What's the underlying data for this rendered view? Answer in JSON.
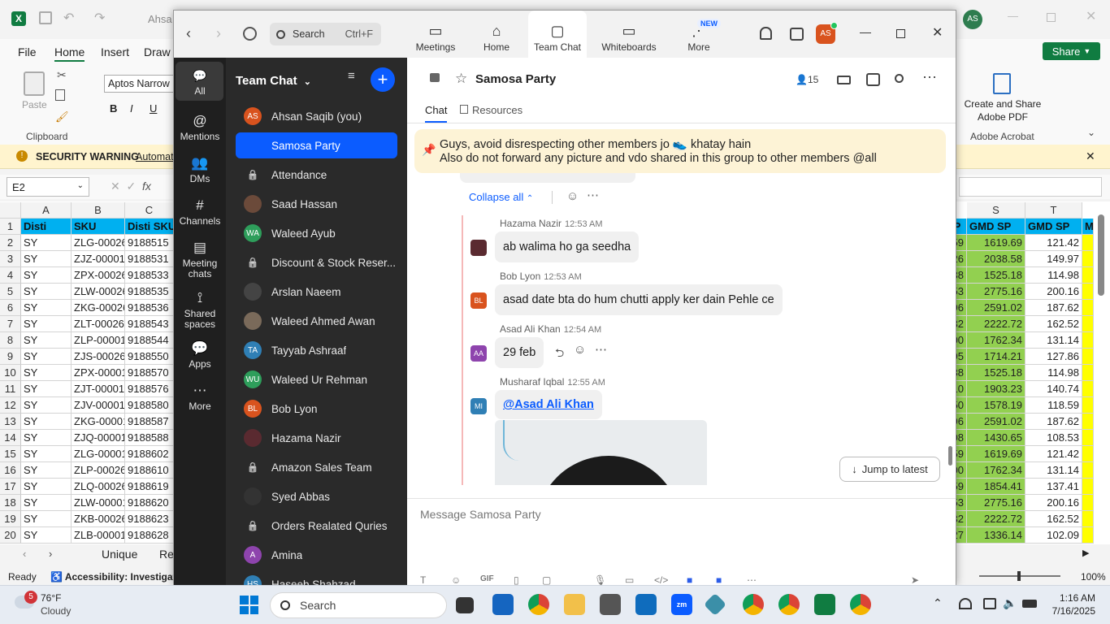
{
  "excel": {
    "title_partial": "Ahsa",
    "menu": [
      "File",
      "Home",
      "Insert",
      "Draw"
    ],
    "share_label": "Share",
    "clipboard_group": "Clipboard",
    "paste_label": "Paste",
    "font_name": "Aptos Narrow",
    "adobe_button": "Create and Share Adobe PDF",
    "adobe_group": "Adobe Acrobat",
    "security_label": "SECURITY WARNING",
    "security_text": "Automat",
    "name_box": "E2",
    "sheet_tab": "Unique",
    "sheet_tab2": "Re",
    "status_ready": "Ready",
    "status_accessibility": "Accessibility: Investigate",
    "zoom_level": "100%",
    "col_headers_left": [
      "A",
      "B",
      "C"
    ],
    "col_headers_right": [
      "S",
      "T"
    ],
    "header_row": {
      "a": "Disti",
      "b": "SKU",
      "c": "Disti SKU",
      "s": "GMD SP",
      "t": "GMD SP",
      "m": "M",
      "r": "SP"
    },
    "rows": [
      {
        "n": "2",
        "a": "SY",
        "b": "ZLG-00026",
        "c": "9188515",
        "r": "59",
        "s": "1619.69",
        "t": "121.42"
      },
      {
        "n": "3",
        "a": "SY",
        "b": "ZJZ-00001",
        "c": "9188531",
        "r": "26",
        "s": "2038.58",
        "t": "149.97"
      },
      {
        "n": "4",
        "a": "SY",
        "b": "ZPX-00026",
        "c": "9188533",
        "r": "38",
        "s": "1525.18",
        "t": "114.98"
      },
      {
        "n": "5",
        "a": "SY",
        "b": "ZLW-00026",
        "c": "9188535",
        "r": "53",
        "s": "2775.16",
        "t": "200.16"
      },
      {
        "n": "6",
        "a": "SY",
        "b": "ZKG-00026",
        "c": "9188536",
        "r": "96",
        "s": "2591.02",
        "t": "187.62"
      },
      {
        "n": "7",
        "a": "SY",
        "b": "ZLT-00026",
        "c": "9188543",
        "r": "32",
        "s": "2222.72",
        "t": "162.52"
      },
      {
        "n": "8",
        "a": "SY",
        "b": "ZLP-00001",
        "c": "9188544",
        "r": "00",
        "s": "1762.34",
        "t": "131.14"
      },
      {
        "n": "9",
        "a": "SY",
        "b": "ZJS-00026",
        "c": "9188550",
        "r": "95",
        "s": "1714.21",
        "t": "127.86"
      },
      {
        "n": "10",
        "a": "SY",
        "b": "ZPX-00001",
        "c": "9188570",
        "r": "38",
        "s": "1525.18",
        "t": "114.98"
      },
      {
        "n": "11",
        "a": "SY",
        "b": "ZJT-00001",
        "c": "9188576",
        "r": "10",
        "s": "1903.23",
        "t": "140.74"
      },
      {
        "n": "12",
        "a": "SY",
        "b": "ZJV-00001",
        "c": "9188580",
        "r": "50",
        "s": "1578.19",
        "t": "118.59"
      },
      {
        "n": "13",
        "a": "SY",
        "b": "ZKG-00001",
        "c": "9188587",
        "r": "96",
        "s": "2591.02",
        "t": "187.62"
      },
      {
        "n": "14",
        "a": "SY",
        "b": "ZJQ-00001",
        "c": "9188588",
        "r": "08",
        "s": "1430.65",
        "t": "108.53"
      },
      {
        "n": "15",
        "a": "SY",
        "b": "ZLG-00001",
        "c": "9188602",
        "r": "59",
        "s": "1619.69",
        "t": "121.42"
      },
      {
        "n": "16",
        "a": "SY",
        "b": "ZLP-00026",
        "c": "9188610",
        "r": "00",
        "s": "1762.34",
        "t": "131.14"
      },
      {
        "n": "17",
        "a": "SY",
        "b": "ZLQ-00026",
        "c": "9188619",
        "r": "59",
        "s": "1854.41",
        "t": "137.41"
      },
      {
        "n": "18",
        "a": "SY",
        "b": "ZLW-00001",
        "c": "9188620",
        "r": "53",
        "s": "2775.16",
        "t": "200.16"
      },
      {
        "n": "19",
        "a": "SY",
        "b": "ZKB-00026",
        "c": "9188623",
        "r": "32",
        "s": "2222.72",
        "t": "162.52"
      },
      {
        "n": "20",
        "a": "SY",
        "b": "ZLB-00001",
        "c": "9188628",
        "r": "27",
        "s": "1336.14",
        "t": "102.09"
      }
    ]
  },
  "zoom": {
    "search_label": "Search",
    "search_shortcut": "Ctrl+F",
    "tabs": [
      {
        "label": "Meetings",
        "icon": "video-icon"
      },
      {
        "label": "Home",
        "icon": "home-icon"
      },
      {
        "label": "Team Chat",
        "icon": "chat-icon"
      },
      {
        "label": "Whiteboards",
        "icon": "whiteboard-icon"
      },
      {
        "label": "More",
        "icon": "more-icon",
        "badge": "NEW"
      }
    ],
    "user_initials": "AS",
    "rail": [
      {
        "label": "All"
      },
      {
        "label": "Mentions"
      },
      {
        "label": "DMs"
      },
      {
        "label": "Channels"
      },
      {
        "label": "Meeting chats"
      },
      {
        "label": "Shared spaces"
      },
      {
        "label": "Apps"
      },
      {
        "label": "More"
      }
    ],
    "list_title": "Team Chat",
    "chats": [
      {
        "name": "Ahsan Saqib (you)",
        "initials": "AS",
        "color": "#d9531e",
        "kind": "avatar"
      },
      {
        "name": "Samosa Party",
        "kind": "group",
        "selected": true
      },
      {
        "name": "Attendance",
        "kind": "lock"
      },
      {
        "name": "Saad Hassan",
        "initials": "",
        "color": "#6b4a3a",
        "kind": "avatar"
      },
      {
        "name": "Waleed Ayub",
        "initials": "WA",
        "color": "#2e9e5b",
        "kind": "avatar"
      },
      {
        "name": "Discount & Stock Reser...",
        "kind": "lock"
      },
      {
        "name": "Arslan Naeem",
        "initials": "",
        "color": "#444",
        "kind": "avatar"
      },
      {
        "name": "Waleed Ahmed Awan",
        "initials": "",
        "color": "#7a6a5a",
        "kind": "avatar"
      },
      {
        "name": "Tayyab Ashraaf",
        "initials": "TA",
        "color": "#2f7fb5",
        "kind": "avatar"
      },
      {
        "name": "Waleed Ur Rehman",
        "initials": "WU",
        "color": "#2e9e5b",
        "kind": "avatar"
      },
      {
        "name": "Bob Lyon",
        "initials": "BL",
        "color": "#d9531e",
        "kind": "avatar"
      },
      {
        "name": "Hazama Nazir",
        "initials": "",
        "color": "#5a2a30",
        "kind": "avatar"
      },
      {
        "name": "Amazon Sales Team",
        "kind": "lock"
      },
      {
        "name": "Syed Abbas",
        "initials": "",
        "color": "#333",
        "kind": "avatar"
      },
      {
        "name": "Orders Realated Quries",
        "kind": "lock"
      },
      {
        "name": "Amina",
        "initials": "A",
        "color": "#8e44ad",
        "kind": "avatar"
      },
      {
        "name": "Haseeb Shahzad",
        "initials": "HS",
        "color": "#2f7fb5",
        "kind": "avatar"
      }
    ],
    "channel_name": "Samosa Party",
    "member_count": "15",
    "sub_tabs": [
      "Chat",
      "Resources"
    ],
    "pinned_line1": "Guys, avoid disrespecting other members jo",
    "pinned_line1_tail": "khatay hain",
    "pinned_line2": "Also do not forward any picture and vdo shared in this group to other members @all",
    "collapse_label": "Collapse all",
    "messages": [
      {
        "name": "Hazama Nazir",
        "time": "12:53 AM",
        "text": "ab walima ho ga seedha",
        "initials": "",
        "color": "#5a2a30"
      },
      {
        "name": "Bob Lyon",
        "time": "12:53 AM",
        "text": "asad date bta do hum chutti apply ker dain Pehle ce",
        "initials": "BL",
        "color": "#d9531e"
      },
      {
        "name": "Asad Ali Khan",
        "time": "12:54 AM",
        "text": "29 feb",
        "initials": "AA",
        "color": "#8e44ad"
      },
      {
        "name": "Musharaf Iqbal",
        "time": "12:55 AM",
        "text": "@Asad Ali Khan",
        "initials": "MI",
        "color": "#2f7fb5"
      }
    ],
    "jump_label": "Jump to latest",
    "composer_placeholder": "Message Samosa Party"
  },
  "taskbar": {
    "weather_temp": "76°F",
    "weather_cond": "Cloudy",
    "weather_badge": "5",
    "search_label": "Search",
    "time": "1:16 AM",
    "date": "7/16/2025"
  }
}
